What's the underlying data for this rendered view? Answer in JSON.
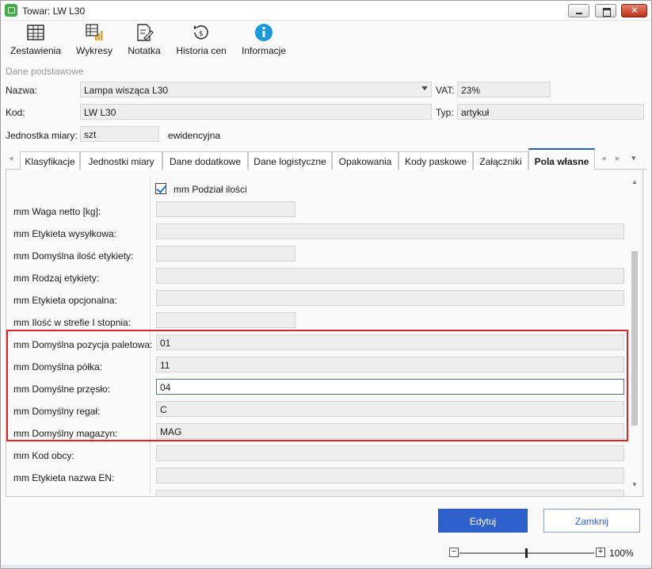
{
  "window": {
    "title": "Towar: LW L30"
  },
  "toolbar": {
    "items": [
      {
        "label": "Zestawienia",
        "icon": "table-icon"
      },
      {
        "label": "Wykresy",
        "icon": "chart-icon"
      },
      {
        "label": "Notatka",
        "icon": "note-icon"
      },
      {
        "label": "Historia cen",
        "icon": "history-icon"
      },
      {
        "label": "Informacje",
        "icon": "info-icon"
      }
    ]
  },
  "basic": {
    "section_label": "Dane podstawowe",
    "name_label": "Nazwa:",
    "name_value": "Lampa wisząca L30",
    "vat_label": "VAT:",
    "vat_value": "23%",
    "code_label": "Kod:",
    "code_value": "LW L30",
    "type_label": "Typ:",
    "type_value": "artykuł",
    "unit_label": "Jednostka miary:",
    "unit_value": "szt",
    "unit_note": "ewidencyjna"
  },
  "tabs": [
    {
      "label": "Klasyfikacje"
    },
    {
      "label": "Jednostki miary"
    },
    {
      "label": "Dane dodatkowe"
    },
    {
      "label": "Dane logistyczne"
    },
    {
      "label": "Opakowania"
    },
    {
      "label": "Kody paskowe"
    },
    {
      "label": "Załączniki"
    },
    {
      "label": "Pola własne"
    }
  ],
  "custom_fields": {
    "checkbox_label": "mm Podział ilości",
    "checkbox_checked": true,
    "rows": [
      {
        "label": "mm Waga netto [kg]:",
        "value": ""
      },
      {
        "label": "mm Etykieta wysyłkowa:",
        "value": ""
      },
      {
        "label": "mm Domyślna ilość etykiety:",
        "value": ""
      },
      {
        "label": "mm Rodzaj etykiety:",
        "value": ""
      },
      {
        "label": "mm Etykieta opcjonalna:",
        "value": ""
      },
      {
        "label": "mm Ilość w strefie I stopnia:",
        "value": ""
      },
      {
        "label": "mm Domyślna pozycja paletowa:",
        "value": "01"
      },
      {
        "label": "mm Domyślna półka:",
        "value": "11"
      },
      {
        "label": "mm Domyślne przęsło:",
        "value": "04"
      },
      {
        "label": "mm Domyślny regał:",
        "value": "C"
      },
      {
        "label": "mm Domyślny magazyn:",
        "value": "MAG"
      },
      {
        "label": "mm Kod obcy:",
        "value": ""
      },
      {
        "label": "mm Etykieta nazwa EN:",
        "value": ""
      }
    ]
  },
  "buttons": {
    "edit": "Edytuj",
    "close": "Zamknij"
  },
  "zoom": {
    "minus": "−",
    "plus": "+",
    "percent": "100%",
    "level": 0.5
  },
  "colors": {
    "accent": "#2e61cc",
    "highlight": "#d42828",
    "app_icon": "#3cb043"
  }
}
